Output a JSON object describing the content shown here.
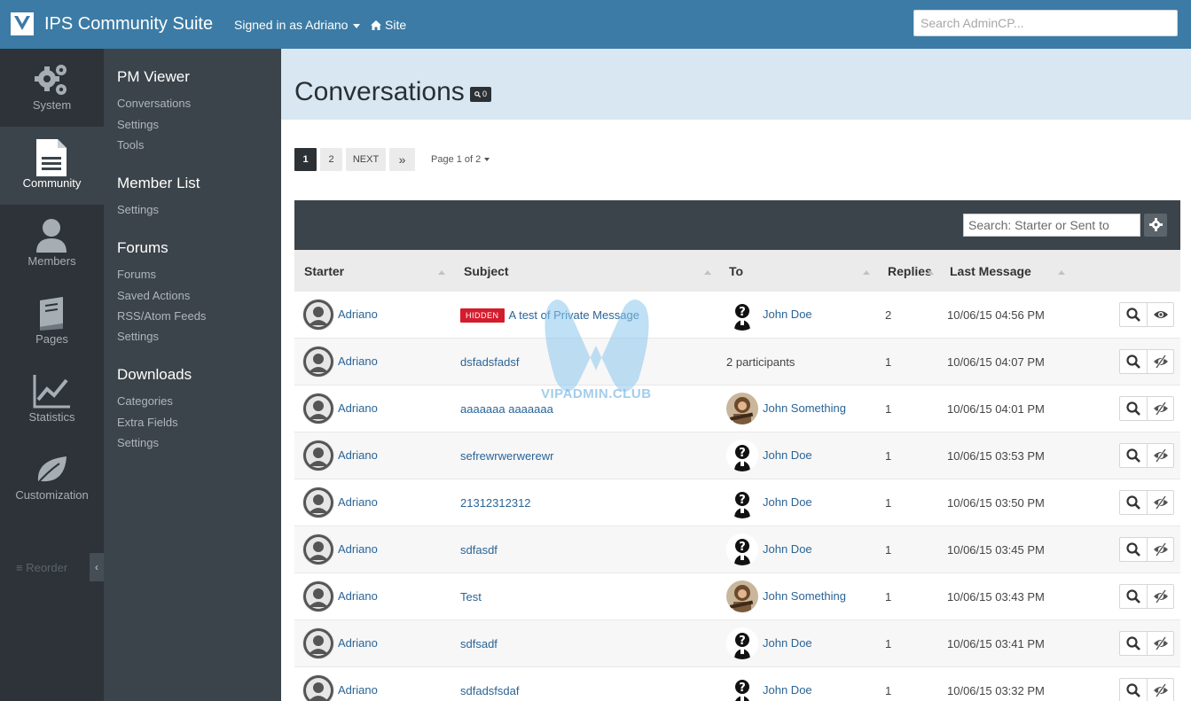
{
  "topbar": {
    "brand": "IPS Community Suite",
    "signed_in": "Signed in as Adriano",
    "site_link": "Site",
    "search_placeholder": "Search AdminCP..."
  },
  "rail": {
    "items": [
      {
        "label": "System",
        "icon": "gears-icon"
      },
      {
        "label": "Community",
        "icon": "document-icon"
      },
      {
        "label": "Members",
        "icon": "user-icon"
      },
      {
        "label": "Pages",
        "icon": "book-icon"
      },
      {
        "label": "Statistics",
        "icon": "chart-icon"
      },
      {
        "label": "Customization",
        "icon": "leaf-icon"
      }
    ],
    "reorder": "Reorder"
  },
  "subnav": {
    "pm_viewer": {
      "title": "PM Viewer",
      "links": [
        "Conversations",
        "Settings",
        "Tools"
      ]
    },
    "member_list": {
      "title": "Member List",
      "links": [
        "Settings"
      ]
    },
    "forums": {
      "title": "Forums",
      "links": [
        "Forums",
        "Saved Actions",
        "RSS/Atom Feeds",
        "Settings"
      ]
    },
    "downloads": {
      "title": "Downloads",
      "links": [
        "Categories",
        "Extra Fields",
        "Settings"
      ]
    }
  },
  "page": {
    "title": "Conversations",
    "badge": "0"
  },
  "pagination": {
    "pages": [
      "1",
      "2"
    ],
    "next": "NEXT",
    "last": "»",
    "info": "Page 1 of 2"
  },
  "table": {
    "search_placeholder": "Search: Starter or Sent to",
    "columns": {
      "starter": "Starter",
      "subject": "Subject",
      "to": "To",
      "replies": "Replies",
      "last_message": "Last Message"
    },
    "hidden_label": "HIDDEN",
    "rows": [
      {
        "starter": "Adriano",
        "subject": "A test of Private Message",
        "hidden": true,
        "to": "John Doe",
        "to_avatar": "silhouette",
        "replies": "2",
        "last": "10/06/15 04:56 PM"
      },
      {
        "starter": "Adriano",
        "subject": "dsfadsfadsf",
        "hidden": false,
        "to": "2 participants",
        "to_avatar": "none",
        "replies": "1",
        "last": "10/06/15 04:07 PM"
      },
      {
        "starter": "Adriano",
        "subject": "aaaaaaa aaaaaaa",
        "hidden": false,
        "to": "John Something",
        "to_avatar": "photo",
        "replies": "1",
        "last": "10/06/15 04:01 PM"
      },
      {
        "starter": "Adriano",
        "subject": "sefrewrwerwerewr",
        "hidden": false,
        "to": "John Doe",
        "to_avatar": "silhouette",
        "replies": "1",
        "last": "10/06/15 03:53 PM"
      },
      {
        "starter": "Adriano",
        "subject": "21312312312",
        "hidden": false,
        "to": "John Doe",
        "to_avatar": "silhouette",
        "replies": "1",
        "last": "10/06/15 03:50 PM"
      },
      {
        "starter": "Adriano",
        "subject": "sdfasdf",
        "hidden": false,
        "to": "John Doe",
        "to_avatar": "silhouette",
        "replies": "1",
        "last": "10/06/15 03:45 PM"
      },
      {
        "starter": "Adriano",
        "subject": "Test",
        "hidden": false,
        "to": "John Something",
        "to_avatar": "photo",
        "replies": "1",
        "last": "10/06/15 03:43 PM"
      },
      {
        "starter": "Adriano",
        "subject": "sdfsadf",
        "hidden": false,
        "to": "John Doe",
        "to_avatar": "silhouette",
        "replies": "1",
        "last": "10/06/15 03:41 PM"
      },
      {
        "starter": "Adriano",
        "subject": "sdfadsfsdaf",
        "hidden": false,
        "to": "John Doe",
        "to_avatar": "silhouette",
        "replies": "1",
        "last": "10/06/15 03:32 PM"
      }
    ]
  },
  "watermark": "VIPADMIN.CLUB",
  "colors": {
    "topbar": "#3c7ba5",
    "rail": "#2d3338",
    "subnav": "#3c444b",
    "header_band": "#d8e7f2",
    "link": "#2a6496",
    "hidden_badge": "#d41c2d"
  }
}
